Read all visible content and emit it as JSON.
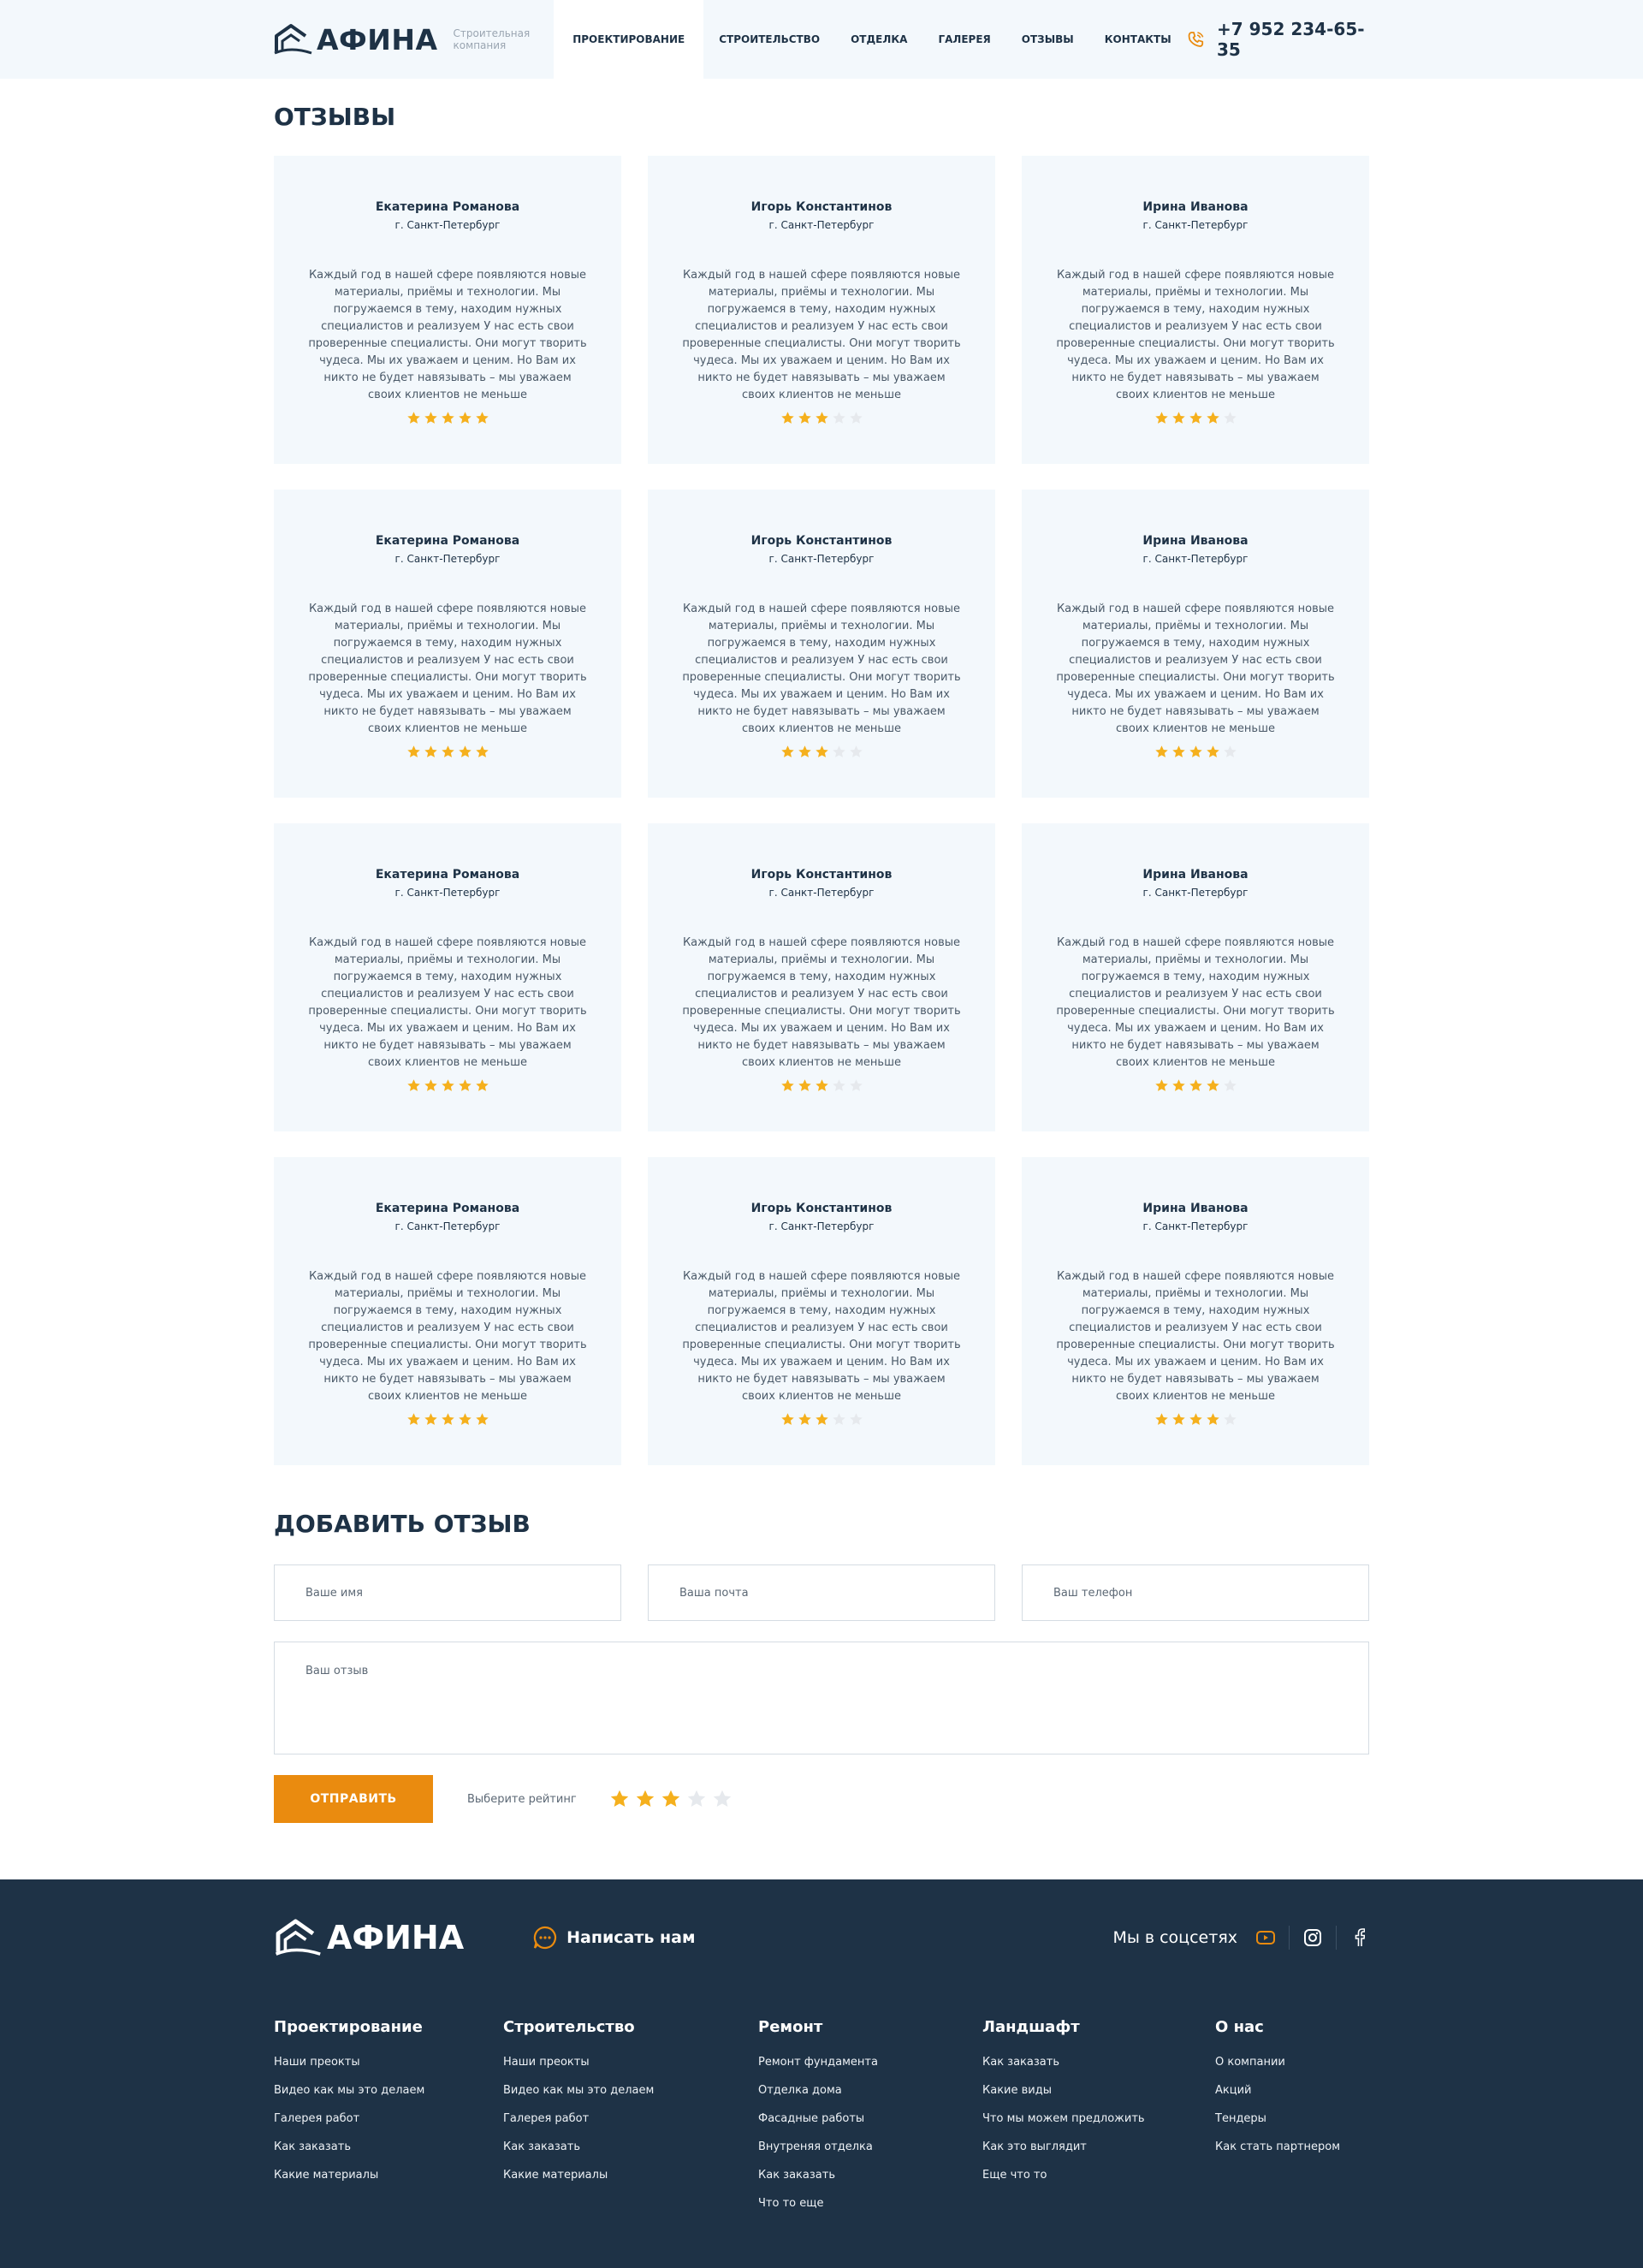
{
  "header": {
    "logo": "АФИНА",
    "tagline": "Строительная компания",
    "nav": [
      "Проектирование",
      "Строительство",
      "Отделка",
      "Галерея",
      "Отзывы",
      "Контакты"
    ],
    "phone": "+7 952 234-65-35",
    "phone_icon": "phone-icon"
  },
  "reviews": {
    "title": "ОТЗЫВЫ",
    "max_rating": 5,
    "items": [
      {
        "name": "Екатерина Романова",
        "city": "г. Санкт-Петербург",
        "text": "Каждый год в нашей сфере появляются новые материалы, приёмы и технологии. Мы погружаемся в тему, находим нужных специалистов и реализуем У нас есть свои проверенные специалисты. Они могут творить чудеса. Мы их уважаем и ценим. Но Вам их никто не будет навязывать – мы уважаем своих клиентов не меньше",
        "rating": 5
      },
      {
        "name": "Игорь Константинов",
        "city": "г. Санкт-Петербург",
        "text": "Каждый год в нашей сфере появляются новые материалы, приёмы и технологии. Мы погружаемся в тему, находим нужных специалистов и реализуем У нас есть свои проверенные специалисты. Они могут творить чудеса. Мы их уважаем и ценим. Но Вам их никто не будет навязывать – мы уважаем своих клиентов не меньше",
        "rating": 3
      },
      {
        "name": "Ирина Иванова",
        "city": "г. Санкт-Петербург",
        "text": "Каждый год в нашей сфере появляются новые материалы, приёмы и технологии. Мы погружаемся в тему, находим нужных специалистов и реализуем У нас есть свои проверенные специалисты. Они могут творить чудеса. Мы их уважаем и ценим. Но Вам их никто не будет навязывать – мы уважаем своих клиентов не меньше",
        "rating": 4
      },
      {
        "name": "Екатерина Романова",
        "city": "г. Санкт-Петербург",
        "text": "Каждый год в нашей сфере появляются новые материалы, приёмы и технологии. Мы погружаемся в тему, находим нужных специалистов и реализуем У нас есть свои проверенные специалисты. Они могут творить чудеса. Мы их уважаем и ценим. Но Вам их никто не будет навязывать – мы уважаем своих клиентов не меньше",
        "rating": 5
      },
      {
        "name": "Игорь Константинов",
        "city": "г. Санкт-Петербург",
        "text": "Каждый год в нашей сфере появляются новые материалы, приёмы и технологии. Мы погружаемся в тему, находим нужных специалистов и реализуем У нас есть свои проверенные специалисты. Они могут творить чудеса. Мы их уважаем и ценим. Но Вам их никто не будет навязывать – мы уважаем своих клиентов не меньше",
        "rating": 3
      },
      {
        "name": "Ирина Иванова",
        "city": "г. Санкт-Петербург",
        "text": "Каждый год в нашей сфере появляются новые материалы, приёмы и технологии. Мы погружаемся в тему, находим нужных специалистов и реализуем У нас есть свои проверенные специалисты. Они могут творить чудеса. Мы их уважаем и ценим. Но Вам их никто не будет навязывать – мы уважаем своих клиентов не меньше",
        "rating": 4
      },
      {
        "name": "Екатерина Романова",
        "city": "г. Санкт-Петербург",
        "text": "Каждый год в нашей сфере появляются новые материалы, приёмы и технологии. Мы погружаемся в тему, находим нужных специалистов и реализуем У нас есть свои проверенные специалисты. Они могут творить чудеса. Мы их уважаем и ценим. Но Вам их никто не будет навязывать – мы уважаем своих клиентов не меньше",
        "rating": 5
      },
      {
        "name": "Игорь Константинов",
        "city": "г. Санкт-Петербург",
        "text": "Каждый год в нашей сфере появляются новые материалы, приёмы и технологии. Мы погружаемся в тему, находим нужных специалистов и реализуем У нас есть свои проверенные специалисты. Они могут творить чудеса. Мы их уважаем и ценим. Но Вам их никто не будет навязывать – мы уважаем своих клиентов не меньше",
        "rating": 3
      },
      {
        "name": "Ирина Иванова",
        "city": "г. Санкт-Петербург",
        "text": "Каждый год в нашей сфере появляются новые материалы, приёмы и технологии. Мы погружаемся в тему, находим нужных специалистов и реализуем У нас есть свои проверенные специалисты. Они могут творить чудеса. Мы их уважаем и ценим. Но Вам их никто не будет навязывать – мы уважаем своих клиентов не меньше",
        "rating": 4
      },
      {
        "name": "Екатерина Романова",
        "city": "г. Санкт-Петербург",
        "text": "Каждый год в нашей сфере появляются новые материалы, приёмы и технологии. Мы погружаемся в тему, находим нужных специалистов и реализуем У нас есть свои проверенные специалисты. Они могут творить чудеса. Мы их уважаем и ценим. Но Вам их никто не будет навязывать – мы уважаем своих клиентов не меньше",
        "rating": 5
      },
      {
        "name": "Игорь Константинов",
        "city": "г. Санкт-Петербург",
        "text": "Каждый год в нашей сфере появляются новые материалы, приёмы и технологии. Мы погружаемся в тему, находим нужных специалистов и реализуем У нас есть свои проверенные специалисты. Они могут творить чудеса. Мы их уважаем и ценим. Но Вам их никто не будет навязывать – мы уважаем своих клиентов не меньше",
        "rating": 3
      },
      {
        "name": "Ирина Иванова",
        "city": "г. Санкт-Петербург",
        "text": "Каждый год в нашей сфере появляются новые материалы, приёмы и технологии. Мы погружаемся в тему, находим нужных специалистов и реализуем У нас есть свои проверенные специалисты. Они могут творить чудеса. Мы их уважаем и ценим. Но Вам их никто не будет навязывать – мы уважаем своих клиентов не меньше",
        "rating": 4
      }
    ]
  },
  "form": {
    "title": "ДОБАВИТЬ ОТЗЫВ",
    "name_placeholder": "Ваше имя",
    "email_placeholder": "Ваша почта",
    "phone_placeholder": "Ваш телефон",
    "review_placeholder": "Ваш отзыв",
    "submit_label": "ОТПРАВИТЬ",
    "rating_label": "Выберите рейтинг",
    "selected_rating": 3
  },
  "footer": {
    "logo": "АФИНА",
    "write_us": "Написать нам",
    "socials_label": "Мы в соцсетях",
    "social_icons": [
      "youtube-icon",
      "instagram-icon",
      "facebook-icon"
    ],
    "columns": [
      {
        "title": "Проектирование",
        "links": [
          "Наши преокты",
          "Видео как мы это делаем",
          "Галерея работ",
          "Как заказать",
          "Какие материалы"
        ]
      },
      {
        "title": "Строительство",
        "links": [
          "Наши преокты",
          "Видео как мы это делаем",
          "Галерея работ",
          "Как заказать",
          "Какие материалы"
        ]
      },
      {
        "title": "Ремонт",
        "links": [
          "Ремонт фундамента",
          "Отделка дома",
          "Фасадные работы",
          "Внутреняя отделка",
          "Как заказать",
          "Что то еще"
        ]
      },
      {
        "title": "Ландшафт",
        "links": [
          "Как заказать",
          "Какие виды",
          "Что мы можем предложить",
          "Как это выглядит",
          "Еще что то"
        ]
      },
      {
        "title": "О нас",
        "links": [
          "О компании",
          "Акций",
          "Тендеры",
          "Как стать партнером"
        ]
      }
    ]
  },
  "colors": {
    "accent": "#ea8b0f",
    "star_active": "#f5b01d",
    "star_inactive": "#e6e9ed",
    "dark": "#1e3246",
    "light_bg": "#f3f8fc"
  }
}
